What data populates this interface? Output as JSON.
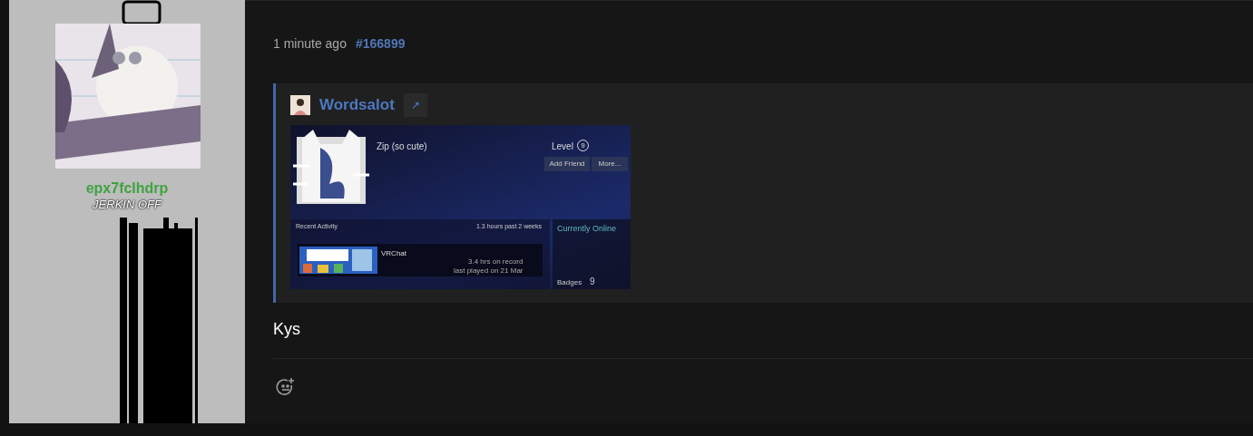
{
  "author": {
    "username": "epx7fclhdrp",
    "user_title": "JERKIN OFF"
  },
  "post": {
    "time": "1 minute ago",
    "post_number": "#166899",
    "quote": {
      "author": "Wordsalot",
      "jump_link": "↗",
      "screenshot": {
        "profile_name": "Zip (so cute)",
        "level_label": "Level",
        "level": "9",
        "buttons": [
          "Add Friend",
          "More..."
        ],
        "recent_activity": "Recent Activity",
        "playtime": "1.3 hours past 2 weeks",
        "status": "Currently Online",
        "game": {
          "name": "VRChat",
          "hours": "3.4 hrs on record",
          "last_played": "last played on 21 Mar"
        },
        "badges_label": "Badges",
        "badges": "9"
      }
    },
    "body": "Kys"
  }
}
